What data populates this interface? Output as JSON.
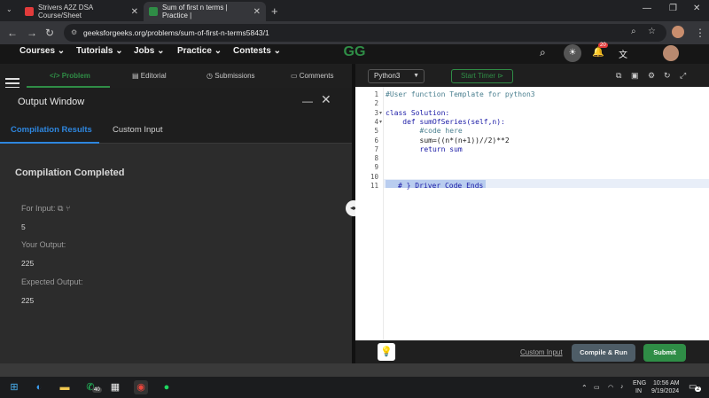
{
  "browser": {
    "tabs": [
      {
        "label": "Strivers A2Z DSA Course/Sheet",
        "favicon_color": "#e23b3b"
      },
      {
        "label": "Sum of first n terms | Practice |",
        "favicon_color": "#2f8d46"
      }
    ],
    "new_tab_label": "+",
    "url": "geeksforgeeks.org/problems/sum-of-first-n-terms5843/1"
  },
  "site_nav": {
    "items": [
      "Courses",
      "Tutorials",
      "Jobs",
      "Practice",
      "Contests"
    ],
    "logo": "GG",
    "notification_count": "20"
  },
  "problem_tabs": [
    "Problem",
    "Editorial",
    "Submissions",
    "Comments"
  ],
  "output_window": {
    "title": "Output Window",
    "tabs": [
      "Compilation Results",
      "Custom Input"
    ],
    "status": "Compilation Completed",
    "for_input_label": "For Input:",
    "input_value": "5",
    "your_output_label": "Your Output:",
    "your_output_value": "225",
    "expected_output_label": "Expected Output:",
    "expected_output_value": "225"
  },
  "editor": {
    "language": "Python3",
    "timer_label": "Start Timer",
    "line_numbers": [
      "1",
      "2",
      "3",
      "4",
      "5",
      "6",
      "7",
      "8",
      "9",
      "10",
      "11"
    ],
    "lines": [
      "#User function Template for python3",
      "",
      "class Solution:",
      "    def sumOfSeries(self,n):",
      "        #code here",
      "        sum=((n*(n+1))//2)**2",
      "        return sum",
      "",
      "",
      "",
      "# } Driver Code Ends"
    ],
    "line11_prefix": "",
    "custom_input_link": "Custom Input",
    "compile_run_label": "Compile & Run",
    "submit_label": "Submit"
  },
  "taskbar": {
    "whatsapp_badge": "40",
    "language": "ENG",
    "region": "IN",
    "time": "10:56 AM",
    "date": "9/19/2024",
    "notification_badge": "2"
  },
  "colors": {
    "accent_green": "#2f8d46",
    "accent_blue": "#2e86de",
    "panel_dark": "#2c2c2c"
  }
}
